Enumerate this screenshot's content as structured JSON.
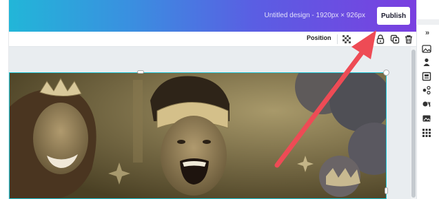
{
  "topbar": {
    "doc_title": "Untitled design - 1920px × 926px",
    "publish_label": "Publish"
  },
  "toolbar": {
    "position_label": "Position",
    "icons": [
      "transparency-icon",
      "lock-icon",
      "copy-icon",
      "trash-icon"
    ]
  },
  "right_panel": {
    "icons": [
      "photo-icon",
      "person-icon",
      "template-icon",
      "elements-icon",
      "uploads-icon",
      "image-icon",
      "grid-icon"
    ]
  },
  "colors": {
    "gradient_start": "#22b6d8",
    "gradient_end": "#7a3fe0",
    "selection": "#1fc8d8",
    "annotation_arrow": "#ee4b55",
    "photo_tint": "#6e6134"
  }
}
